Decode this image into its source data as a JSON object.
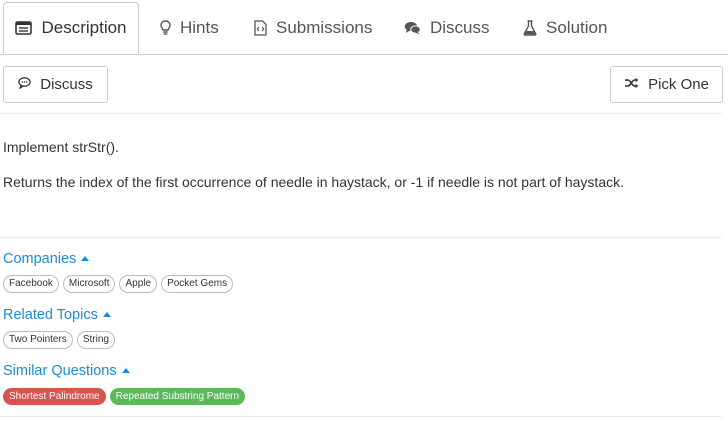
{
  "tabs": [
    {
      "label": "Description",
      "icon": "description-icon",
      "active": true
    },
    {
      "label": "Hints",
      "icon": "lightbulb-icon"
    },
    {
      "label": "Submissions",
      "icon": "code-file-icon"
    },
    {
      "label": "Discuss",
      "icon": "comments-icon"
    },
    {
      "label": "Solution",
      "icon": "flask-icon"
    }
  ],
  "toolbar": {
    "discuss_label": "Discuss",
    "pick_one_label": "Pick One"
  },
  "description": {
    "line1": "Implement strStr().",
    "line2": "Returns the index of the first occurrence of needle in haystack, or -1 if needle is not part of haystack."
  },
  "companies": {
    "title": "Companies",
    "tags": [
      "Facebook",
      "Microsoft",
      "Apple",
      "Pocket Gems"
    ]
  },
  "related_topics": {
    "title": "Related Topics",
    "tags": [
      "Two Pointers",
      "String"
    ]
  },
  "similar_questions": {
    "title": "Similar Questions",
    "tags": [
      {
        "label": "Shortest Palindrome",
        "color": "#d9534f"
      },
      {
        "label": "Repeated Substring Pattern",
        "color": "#5cb85c"
      }
    ]
  },
  "colors": {
    "link": "#1d8bd1",
    "hard": "#d9534f",
    "easy": "#5cb85c"
  }
}
